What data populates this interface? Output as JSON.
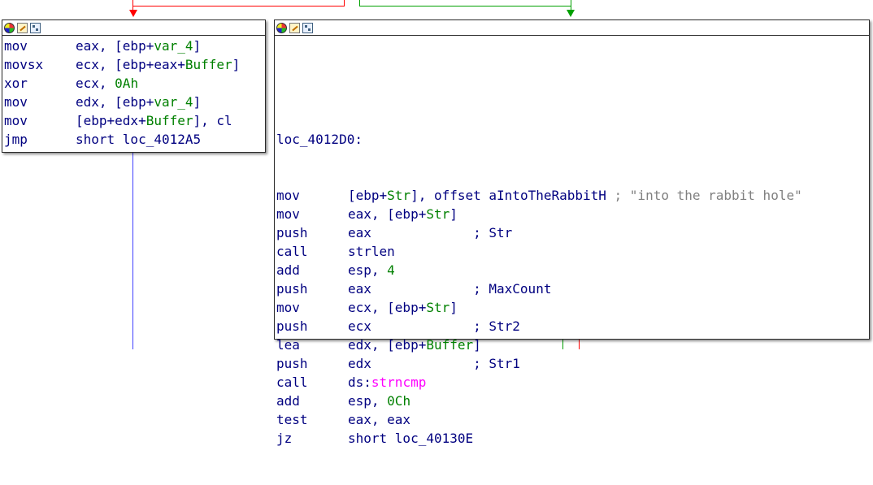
{
  "colors": {
    "false_edge": "#ff0000",
    "true_edge": "#00a000",
    "unconditional_edge": "#4040ff",
    "code_text": "#000080",
    "variable": "#008000",
    "import": "#ff00ff",
    "comment": "#808080"
  },
  "node_toolbar": {
    "icons": [
      "color-palette-icon",
      "rename-icon",
      "graph-overview-icon"
    ]
  },
  "left_block": {
    "lines": [
      {
        "mnemonic": "mov",
        "ops": [
          {
            "t": "eax, [ebp+"
          },
          {
            "t": "var_4",
            "c": "grn"
          },
          {
            "t": "]"
          }
        ]
      },
      {
        "mnemonic": "movsx",
        "ops": [
          {
            "t": "ecx, [ebp+eax+"
          },
          {
            "t": "Buffer",
            "c": "grn"
          },
          {
            "t": "]"
          }
        ]
      },
      {
        "mnemonic": "xor",
        "ops": [
          {
            "t": "ecx, "
          },
          {
            "t": "0Ah",
            "c": "grn"
          }
        ]
      },
      {
        "mnemonic": "mov",
        "ops": [
          {
            "t": "edx, [ebp+"
          },
          {
            "t": "var_4",
            "c": "grn"
          },
          {
            "t": "]"
          }
        ]
      },
      {
        "mnemonic": "mov",
        "ops": [
          {
            "t": "[ebp+edx+"
          },
          {
            "t": "Buffer",
            "c": "grn"
          },
          {
            "t": "], cl"
          }
        ]
      },
      {
        "mnemonic": "jmp",
        "ops": [
          {
            "t": "short loc_4012A5"
          }
        ]
      }
    ]
  },
  "right_block": {
    "label": "loc_4012D0:",
    "lines": [
      {
        "mnemonic": "mov",
        "ops": [
          {
            "t": "[ebp+"
          },
          {
            "t": "Str",
            "c": "grn"
          },
          {
            "t": "], offset aIntoTheRabbitH "
          },
          {
            "t": "; \"into the rabbit hole\"",
            "c": "gry"
          }
        ]
      },
      {
        "mnemonic": "mov",
        "ops": [
          {
            "t": "eax, [ebp+"
          },
          {
            "t": "Str",
            "c": "grn"
          },
          {
            "t": "]"
          }
        ]
      },
      {
        "mnemonic": "push",
        "ops": [
          {
            "t": "eax             ; Str"
          }
        ]
      },
      {
        "mnemonic": "call",
        "ops": [
          {
            "t": "strlen"
          }
        ]
      },
      {
        "mnemonic": "add",
        "ops": [
          {
            "t": "esp, "
          },
          {
            "t": "4",
            "c": "grn"
          }
        ]
      },
      {
        "mnemonic": "push",
        "ops": [
          {
            "t": "eax             ; MaxCount"
          }
        ]
      },
      {
        "mnemonic": "mov",
        "ops": [
          {
            "t": "ecx, [ebp+"
          },
          {
            "t": "Str",
            "c": "grn"
          },
          {
            "t": "]"
          }
        ]
      },
      {
        "mnemonic": "push",
        "ops": [
          {
            "t": "ecx             ; Str2"
          }
        ]
      },
      {
        "mnemonic": "lea",
        "ops": [
          {
            "t": "edx, [ebp+"
          },
          {
            "t": "Buffer",
            "c": "grn"
          },
          {
            "t": "]"
          }
        ]
      },
      {
        "mnemonic": "push",
        "ops": [
          {
            "t": "edx             ; Str1"
          }
        ]
      },
      {
        "mnemonic": "call",
        "ops": [
          {
            "t": "ds:"
          },
          {
            "t": "strncmp",
            "c": "mag"
          }
        ]
      },
      {
        "mnemonic": "add",
        "ops": [
          {
            "t": "esp, "
          },
          {
            "t": "0Ch",
            "c": "grn"
          }
        ]
      },
      {
        "mnemonic": "test",
        "ops": [
          {
            "t": "eax, eax"
          }
        ]
      },
      {
        "mnemonic": "jz",
        "ops": [
          {
            "t": "short loc_40130E"
          }
        ]
      }
    ]
  }
}
